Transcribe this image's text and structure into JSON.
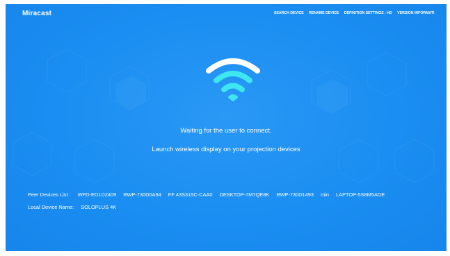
{
  "app": {
    "title": "Miracast"
  },
  "menu": [
    {
      "label": "SEARCH DEVICE"
    },
    {
      "label": "RENAME DEVICE"
    },
    {
      "label": "DEFINITION SETTINGS : HD"
    },
    {
      "label": "VERSION INFORMATI"
    }
  ],
  "status": {
    "waiting": "Waiting for the user to connect.",
    "instruction": "Launch wireless display on your projection devices"
  },
  "peers": {
    "label": "Peer Devices List :",
    "devices": [
      "WFD-ED1D2409",
      "RWP-730D0A94",
      "FF 43S315C-CAA0",
      "DESKTOP-7M7QE8K",
      "RWP-730D1493",
      "min",
      "LAPTOP-5S8M5ADE"
    ]
  },
  "local_device": {
    "label": "Local Device Name:",
    "name": "SOLOPLUS 4K"
  },
  "icons": {
    "wifi": "wifi-icon"
  },
  "colors": {
    "background": "#1a8ef2",
    "wifi_outer": "#ffffff",
    "wifi_inner": "#3ee6f0",
    "text": "#ffffff"
  }
}
